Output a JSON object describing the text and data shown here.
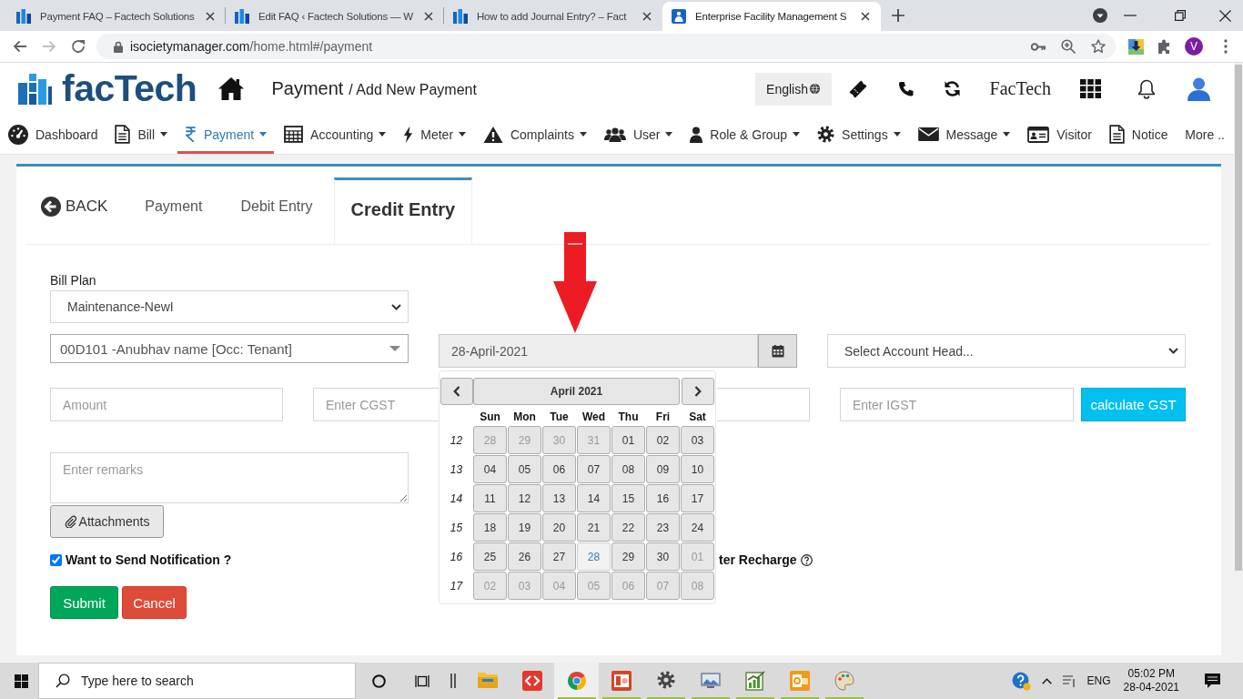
{
  "browser": {
    "tabs": [
      {
        "kind": "site",
        "title": "Payment FAQ – Factech Solutions",
        "selected": false
      },
      {
        "kind": "site",
        "title": "Edit FAQ ‹ Factech Solutions — W",
        "selected": false
      },
      {
        "kind": "site",
        "title": "How to add Journal Entry? – Fact",
        "selected": false
      },
      {
        "kind": "app",
        "title": "Enterprise Facility Management S",
        "selected": true
      }
    ],
    "forward_disabled": true,
    "address": {
      "host": "isocietymanager.com",
      "path": "/home.html#/payment"
    },
    "profile": "V"
  },
  "header": {
    "logo": "facTech",
    "title": "Payment",
    "breadcrumb": "/ Add New Payment",
    "language": "English",
    "account": "FacTech"
  },
  "nav": [
    {
      "kind": "dashboard",
      "label": "Dashboard",
      "dropdown": false,
      "selected": false
    },
    {
      "kind": "bill",
      "label": "Bill",
      "dropdown": true,
      "selected": false
    },
    {
      "kind": "payment",
      "label": "Payment",
      "dropdown": true,
      "selected": true
    },
    {
      "kind": "accounting",
      "label": "Accounting",
      "dropdown": true,
      "selected": false
    },
    {
      "kind": "meter",
      "label": "Meter",
      "dropdown": true,
      "selected": false
    },
    {
      "kind": "complaints",
      "label": "Complaints",
      "dropdown": true,
      "selected": false
    },
    {
      "kind": "users",
      "label": "User",
      "dropdown": true,
      "selected": false
    },
    {
      "kind": "role",
      "label": "Role & Group",
      "dropdown": true,
      "selected": false
    },
    {
      "kind": "settings",
      "label": "Settings",
      "dropdown": true,
      "selected": false
    },
    {
      "kind": "message",
      "label": "Message",
      "dropdown": true,
      "selected": false
    },
    {
      "kind": "visitor",
      "label": "Visitor",
      "dropdown": false,
      "selected": false
    },
    {
      "kind": "notice",
      "label": "Notice",
      "dropdown": false,
      "selected": false
    },
    {
      "kind": "more",
      "label": "More ..",
      "dropdown": false,
      "selected": false
    }
  ],
  "content_tabs": {
    "back": "BACK",
    "items": [
      {
        "label": "Payment",
        "selected": false
      },
      {
        "label": "Debit Entry",
        "selected": false
      },
      {
        "label": "Credit Entry",
        "selected": true
      }
    ]
  },
  "form": {
    "bill_plan": {
      "label": "Bill Plan",
      "value": "Maintenance-NewI"
    },
    "member": {
      "value": "00D101 -Anubhav name [Occ: Tenant]"
    },
    "date": {
      "value": "28-April-2021"
    },
    "account_head": {
      "value": "Select Account Head..."
    },
    "amount": {
      "placeholder": "Amount"
    },
    "cgst": {
      "placeholder": "Enter CGST"
    },
    "igst": {
      "placeholder": "Enter IGST"
    },
    "calculate": "calculate GST",
    "remarks": {
      "placeholder": "Enter remarks"
    },
    "attachments": "Attachments",
    "notification": {
      "label": "Want to Send Notification ?",
      "checked": true
    },
    "recharge_label": "ter Recharge",
    "submit": "Submit",
    "cancel": "Cancel"
  },
  "calendar": {
    "title": "April 2021",
    "weekdays": [
      "Sun",
      "Mon",
      "Tue",
      "Wed",
      "Thu",
      "Fri",
      "Sat"
    ],
    "weeks": [
      {
        "number": "12",
        "days": [
          {
            "label": "28",
            "other_month": true,
            "selected": false
          },
          {
            "label": "29",
            "other_month": true,
            "selected": false
          },
          {
            "label": "30",
            "other_month": true,
            "selected": false
          },
          {
            "label": "31",
            "other_month": true,
            "selected": false
          },
          {
            "label": "01",
            "other_month": false,
            "selected": false
          },
          {
            "label": "02",
            "other_month": false,
            "selected": false
          },
          {
            "label": "03",
            "other_month": false,
            "selected": false
          }
        ]
      },
      {
        "number": "13",
        "days": [
          {
            "label": "04",
            "other_month": false,
            "selected": false
          },
          {
            "label": "05",
            "other_month": false,
            "selected": false
          },
          {
            "label": "06",
            "other_month": false,
            "selected": false
          },
          {
            "label": "07",
            "other_month": false,
            "selected": false
          },
          {
            "label": "08",
            "other_month": false,
            "selected": false
          },
          {
            "label": "09",
            "other_month": false,
            "selected": false
          },
          {
            "label": "10",
            "other_month": false,
            "selected": false
          }
        ]
      },
      {
        "number": "14",
        "days": [
          {
            "label": "11",
            "other_month": false,
            "selected": false
          },
          {
            "label": "12",
            "other_month": false,
            "selected": false
          },
          {
            "label": "13",
            "other_month": false,
            "selected": false
          },
          {
            "label": "14",
            "other_month": false,
            "selected": false
          },
          {
            "label": "15",
            "other_month": false,
            "selected": false
          },
          {
            "label": "16",
            "other_month": false,
            "selected": false
          },
          {
            "label": "17",
            "other_month": false,
            "selected": false
          }
        ]
      },
      {
        "number": "15",
        "days": [
          {
            "label": "18",
            "other_month": false,
            "selected": false
          },
          {
            "label": "19",
            "other_month": false,
            "selected": false
          },
          {
            "label": "20",
            "other_month": false,
            "selected": false
          },
          {
            "label": "21",
            "other_month": false,
            "selected": false
          },
          {
            "label": "22",
            "other_month": false,
            "selected": false
          },
          {
            "label": "23",
            "other_month": false,
            "selected": false
          },
          {
            "label": "24",
            "other_month": false,
            "selected": false
          }
        ]
      },
      {
        "number": "16",
        "days": [
          {
            "label": "25",
            "other_month": false,
            "selected": false
          },
          {
            "label": "26",
            "other_month": false,
            "selected": false
          },
          {
            "label": "27",
            "other_month": false,
            "selected": false
          },
          {
            "label": "28",
            "other_month": false,
            "selected": true
          },
          {
            "label": "29",
            "other_month": false,
            "selected": false
          },
          {
            "label": "30",
            "other_month": false,
            "selected": false
          },
          {
            "label": "01",
            "other_month": true,
            "selected": false
          }
        ]
      },
      {
        "number": "17",
        "days": [
          {
            "label": "02",
            "other_month": true,
            "selected": false
          },
          {
            "label": "03",
            "other_month": true,
            "selected": false
          },
          {
            "label": "04",
            "other_month": true,
            "selected": false
          },
          {
            "label": "05",
            "other_month": true,
            "selected": false
          },
          {
            "label": "06",
            "other_month": true,
            "selected": false
          },
          {
            "label": "07",
            "other_month": true,
            "selected": false
          },
          {
            "label": "08",
            "other_month": true,
            "selected": false
          }
        ]
      }
    ]
  },
  "taskbar": {
    "search_placeholder": "Type here to search",
    "apps": [
      {
        "kind": "folder",
        "running": false,
        "selected": false
      },
      {
        "kind": "arrows",
        "running": false,
        "selected": false
      },
      {
        "kind": "browser",
        "running": true,
        "selected": true
      },
      {
        "kind": "slides",
        "running": true,
        "selected": false
      },
      {
        "kind": "settings",
        "running": true,
        "selected": false
      },
      {
        "kind": "pictures",
        "running": true,
        "selected": false
      },
      {
        "kind": "chart",
        "running": true,
        "selected": false
      },
      {
        "kind": "mail",
        "running": true,
        "selected": false
      },
      {
        "kind": "paint",
        "running": true,
        "selected": false
      }
    ],
    "language": "ENG",
    "time": "05:02 PM",
    "date": "28-04-2021"
  }
}
